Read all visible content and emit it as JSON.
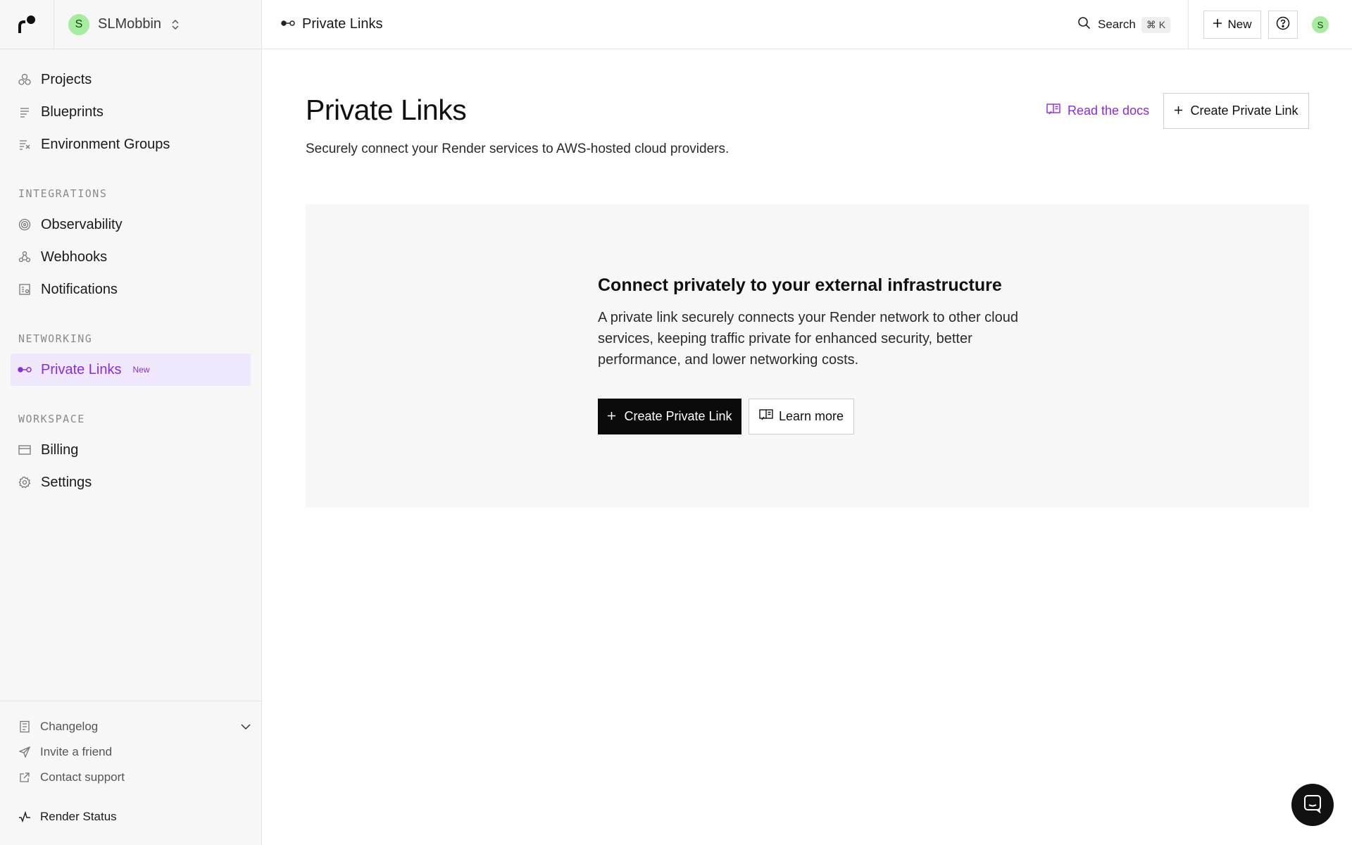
{
  "workspace": {
    "initial": "S",
    "name": "SLMobbin"
  },
  "sidebar": {
    "primary": [
      {
        "label": "Projects",
        "icon": "projects-icon"
      },
      {
        "label": "Blueprints",
        "icon": "blueprints-icon"
      },
      {
        "label": "Environment Groups",
        "icon": "environment-groups-icon"
      }
    ],
    "sections": {
      "integrations": "INTEGRATIONS",
      "networking": "NETWORKING",
      "workspace": "WORKSPACE"
    },
    "integrations": [
      {
        "label": "Observability",
        "icon": "observability-icon"
      },
      {
        "label": "Webhooks",
        "icon": "webhooks-icon"
      },
      {
        "label": "Notifications",
        "icon": "notifications-icon"
      }
    ],
    "networking": [
      {
        "label": "Private Links",
        "icon": "private-links-icon",
        "badge": "New",
        "active": true
      }
    ],
    "workspace_items": [
      {
        "label": "Billing",
        "icon": "billing-icon"
      },
      {
        "label": "Settings",
        "icon": "settings-icon"
      }
    ],
    "bottom": [
      {
        "label": "Changelog",
        "icon": "changelog-icon"
      },
      {
        "label": "Invite a friend",
        "icon": "send-icon"
      },
      {
        "label": "Contact support",
        "icon": "external-link-icon"
      }
    ],
    "status": {
      "label": "Render Status",
      "icon": "activity-icon"
    }
  },
  "header": {
    "breadcrumb": "Private Links",
    "search_label": "Search",
    "search_shortcut": "⌘ K",
    "new_label": "New",
    "user_initial": "S"
  },
  "main": {
    "title": "Private Links",
    "subtitle": "Securely connect your Render services to AWS-hosted cloud providers.",
    "docs_label": "Read the docs",
    "create_label": "Create Private Link",
    "empty": {
      "heading": "Connect privately to your external infrastructure",
      "body": "A private link securely connects your Render network to other cloud services, keeping traffic private for enhanced security, better performance, and lower networking costs.",
      "primary_label": "Create Private Link",
      "secondary_label": "Learn more"
    }
  },
  "colors": {
    "accent": "#8a2be2",
    "active_bg": "#efe7fc",
    "avatar_green": "#a6ec9e",
    "sidebar_bg": "#f7f7f7"
  }
}
